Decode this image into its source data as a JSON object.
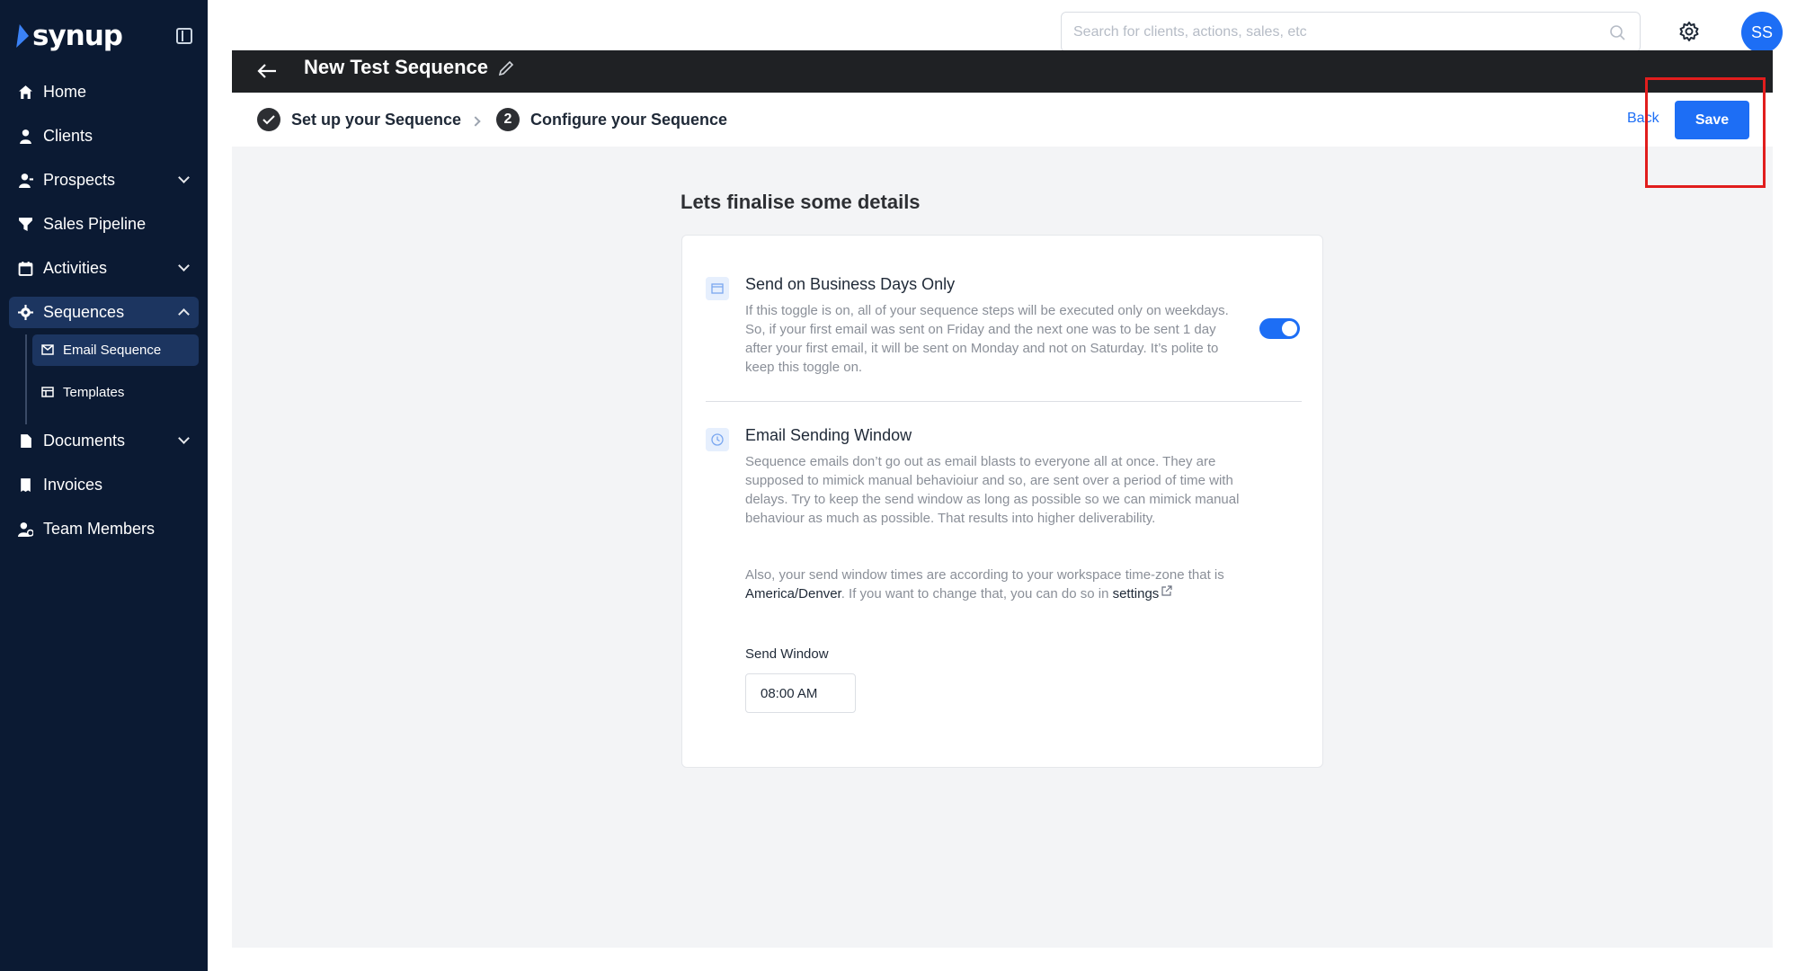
{
  "brand": {
    "name": "synup"
  },
  "sidebar": {
    "items": [
      {
        "label": "Home",
        "icon": "home-icon"
      },
      {
        "label": "Clients",
        "icon": "user-icon"
      },
      {
        "label": "Prospects",
        "icon": "users-icon"
      },
      {
        "label": "Sales Pipeline",
        "icon": "funnel-icon"
      },
      {
        "label": "Activities",
        "icon": "calendar-icon"
      },
      {
        "label": "Sequences",
        "icon": "gear-icon"
      },
      {
        "label": "Documents",
        "icon": "document-icon"
      },
      {
        "label": "Invoices",
        "icon": "receipt-icon"
      },
      {
        "label": "Team Members",
        "icon": "team-icon"
      }
    ],
    "sequences_sub": [
      {
        "label": "Email Sequence",
        "icon": "mail-icon"
      },
      {
        "label": "Templates",
        "icon": "template-icon"
      }
    ]
  },
  "topbar": {
    "search_placeholder": "Search for clients, actions, sales, etc",
    "avatar_initials": "SS"
  },
  "header": {
    "title": "New Test Sequence"
  },
  "steps": {
    "step1_label": "Set up your Sequence",
    "step2_number": "2",
    "step2_label": "Configure your Sequence",
    "back_label": "Back",
    "save_label": "Save"
  },
  "main": {
    "section_title": "Lets finalise some details",
    "business_days": {
      "title": "Send on Business Days Only",
      "description": "If this toggle is on, all of your sequence steps will be executed only on weekdays. So, if your first email was sent on Friday and the next one was to be sent 1 day after your first email, it will be sent on Monday and not on Saturday. It’s polite to keep this toggle on.",
      "toggle_on": true
    },
    "sending_window": {
      "title": "Email Sending Window",
      "description": "Sequence emails don’t go out as email blasts to everyone all at once. They are supposed to mimick manual behavioiur and so, are sent over a period of time with delays. Try to keep the send window as long as possible so we can mimick manual behaviour as much as possible. That results into higher deliverability.",
      "timezone_prefix": "Also, your send window times are according to your workspace time-zone that is ",
      "timezone": "America/Denver",
      "timezone_suffix": ". If you want to change that, you can do so in ",
      "settings_link": "settings",
      "send_window_label": "Send Window",
      "send_window_value": "08:00 AM"
    }
  },
  "colors": {
    "sidebar_bg": "#0b1a33",
    "accent": "#1d6ef5",
    "highlight": "#e11d1d"
  }
}
